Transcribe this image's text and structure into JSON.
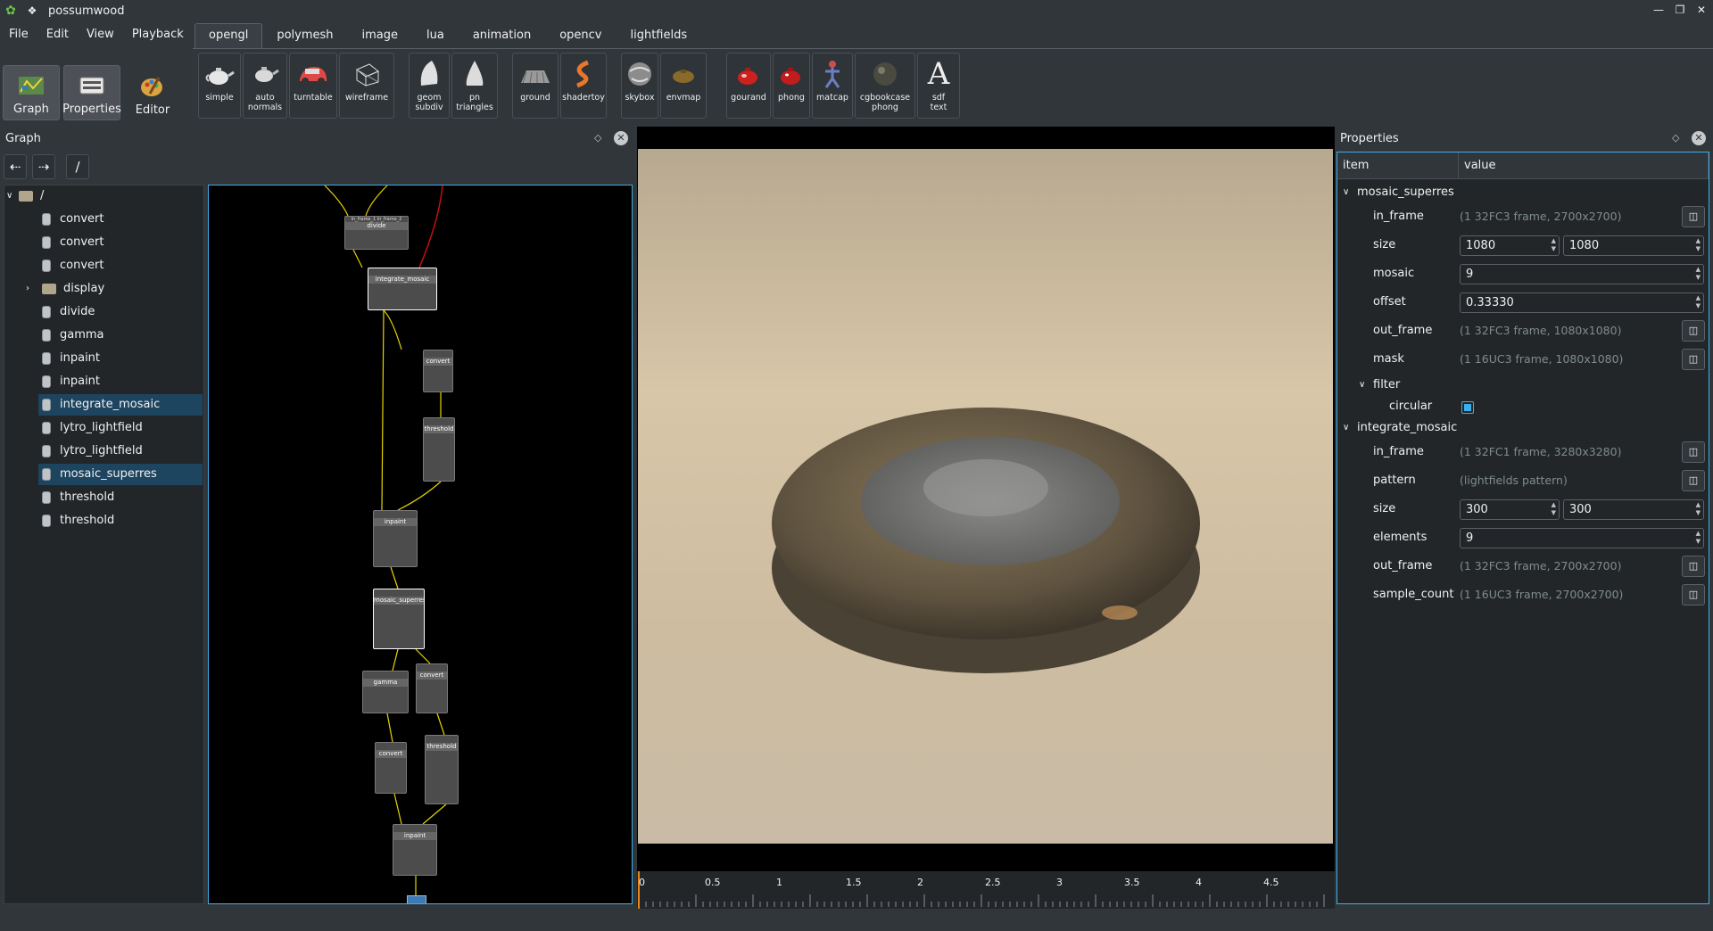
{
  "window": {
    "title": "possumwood"
  },
  "menu": [
    "File",
    "Edit",
    "View",
    "Playback"
  ],
  "modes": [
    {
      "label": "Graph",
      "icon": "graph-icon"
    },
    {
      "label": "Properties",
      "icon": "properties-icon"
    },
    {
      "label": "Editor",
      "icon": "editor-icon"
    }
  ],
  "tabs": [
    "opengl",
    "polymesh",
    "image",
    "lua",
    "animation",
    "opencv",
    "lightfields"
  ],
  "active_tab": "opengl",
  "tools": [
    {
      "l1": "simple",
      "l2": "",
      "icon": "teapot-icon"
    },
    {
      "l1": "auto",
      "l2": "normals",
      "icon": "teapot-icon"
    },
    {
      "l1": "turntable",
      "l2": "",
      "icon": "car-icon"
    },
    {
      "l1": "wireframe",
      "l2": "",
      "icon": "wireframe-cube-icon"
    },
    {
      "l1": "geom",
      "l2": "subdiv",
      "icon": "geometry-icon"
    },
    {
      "l1": "pn",
      "l2": "triangles",
      "icon": "cone-icon"
    },
    {
      "l1": "ground",
      "l2": "",
      "icon": "ground-icon"
    },
    {
      "l1": "shadertoy",
      "l2": "",
      "icon": "shadertoy-icon"
    },
    {
      "l1": "skybox",
      "l2": "",
      "icon": "sphere-icon"
    },
    {
      "l1": "envmap",
      "l2": "",
      "icon": "envmap-icon"
    },
    {
      "l1": "gourand",
      "l2": "",
      "icon": "teapot-icon"
    },
    {
      "l1": "phong",
      "l2": "",
      "icon": "teapot-icon"
    },
    {
      "l1": "matcap",
      "l2": "",
      "icon": "matcap-icon"
    },
    {
      "l1": "cgbookcase",
      "l2": "phong",
      "icon": "stone-icon"
    },
    {
      "l1": "sdf",
      "l2": "text",
      "icon": "text-icon"
    }
  ],
  "graph_panel": {
    "title": "Graph",
    "path_btn": "/",
    "root": "/",
    "items": [
      "convert",
      "convert",
      "convert",
      "display",
      "divide",
      "gamma",
      "inpaint",
      "inpaint",
      "integrate_mosaic",
      "lytro_lightfield",
      "lytro_lightfield",
      "mosaic_superres",
      "threshold",
      "threshold"
    ]
  },
  "graph_nodes": {
    "divide": "divide",
    "integrate_mosaic": "integrate_mosaic",
    "convert1": "convert",
    "threshold1": "threshold",
    "inpaint1": "inpaint",
    "mosaic_superres": "mosaic_superres",
    "gamma": "gamma",
    "convert2": "convert",
    "convert3": "convert",
    "threshold2": "threshold",
    "inpaint2": "inpaint"
  },
  "timeline": {
    "ticks": [
      "0",
      "0.5",
      "1",
      "1.5",
      "2",
      "2.5",
      "3",
      "3.5",
      "4",
      "4.5"
    ]
  },
  "properties": {
    "title": "Properties",
    "col_item": "item",
    "col_value": "value",
    "mosaic_superres": {
      "name": "mosaic_superres",
      "in_frame_label": "in_frame",
      "in_frame": "(1 32FC3 frame, 2700x2700)",
      "size_label": "size",
      "size_w": "1080",
      "size_h": "1080",
      "mosaic_label": "mosaic",
      "mosaic": "9",
      "offset_label": "offset",
      "offset": "0.33330",
      "out_frame_label": "out_frame",
      "out_frame": "(1 32FC3 frame, 1080x1080)",
      "mask_label": "mask",
      "mask": "(1 16UC3 frame, 1080x1080)",
      "filter_label": "filter",
      "circular_label": "circular",
      "circular": true
    },
    "integrate_mosaic": {
      "name": "integrate_mosaic",
      "in_frame_label": "in_frame",
      "in_frame": "(1 32FC1 frame, 3280x3280)",
      "pattern_label": "pattern",
      "pattern": "(lightfields pattern)",
      "size_label": "size",
      "size_w": "300",
      "size_h": "300",
      "elements_label": "elements",
      "elements": "9",
      "out_frame_label": "out_frame",
      "out_frame": "(1 32FC3 frame, 2700x2700)",
      "sample_count_label": "sample_count",
      "sample_count": "(1 16UC3 frame, 2700x2700)"
    }
  },
  "colors": {
    "accent": "#3daee9",
    "bg": "#31363b",
    "panel": "#232629",
    "selection": "#1e4560"
  }
}
